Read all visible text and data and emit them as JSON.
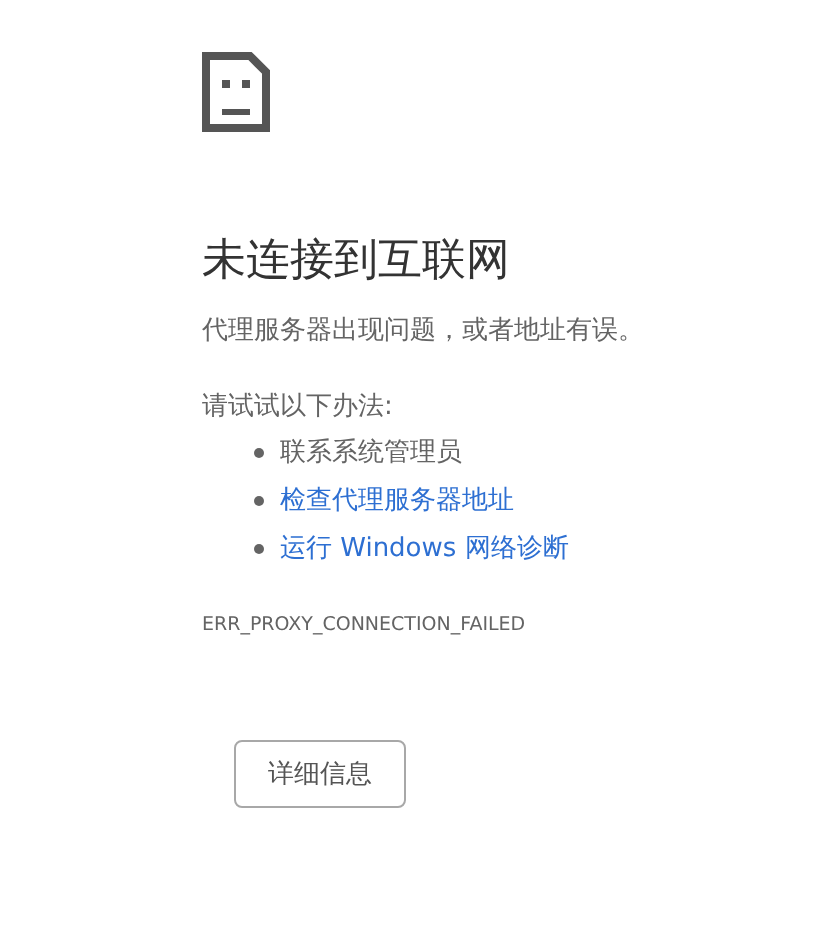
{
  "title": "未连接到互联网",
  "message": "代理服务器出现问题，或者地址有误。",
  "suggestions_heading": "请试试以下办法:",
  "suggestions": [
    {
      "kind": "text",
      "label": "联系系统管理员"
    },
    {
      "kind": "link",
      "label": "检查代理服务器地址"
    },
    {
      "kind": "link",
      "label": "运行 Windows 网络诊断"
    }
  ],
  "error_code": "ERR_PROXY_CONNECTION_FAILED",
  "details_button": "详细信息"
}
